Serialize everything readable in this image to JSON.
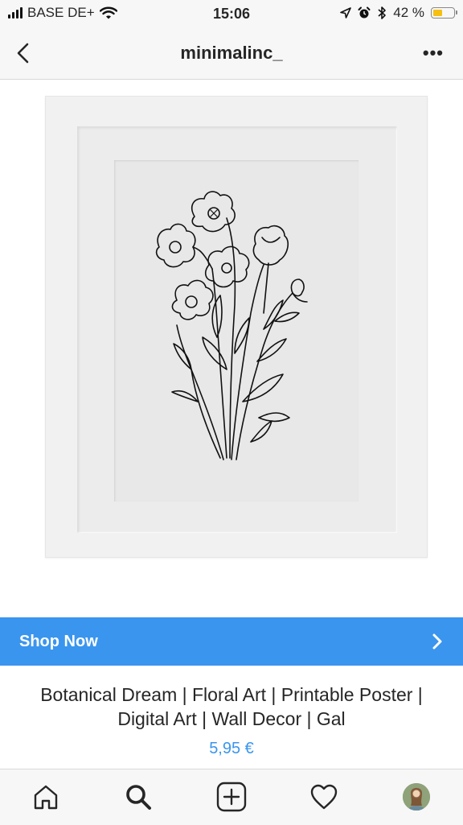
{
  "status_bar": {
    "carrier": "BASE DE+",
    "time": "15:06",
    "battery_percent": "42 %",
    "battery_level": 0.42,
    "icons": [
      "signal-bars-icon",
      "wifi-icon",
      "location-arrow-icon",
      "alarm-icon",
      "bluetooth-icon",
      "battery-icon"
    ]
  },
  "nav": {
    "title": "minimalinc_",
    "back_icon": "chevron-left-icon",
    "more_label": "•••"
  },
  "post": {
    "image_subject": "framed botanical line drawing of poppies"
  },
  "shop": {
    "label": "Shop Now",
    "icon": "chevron-right-icon",
    "accent_color": "#3a95ee"
  },
  "product": {
    "title": "Botanical Dream | Floral Art | Printable Poster | Digital Art | Wall Decor | Gal",
    "price": "5,95 €"
  },
  "tab_bar": {
    "tabs": [
      {
        "name": "home",
        "icon": "home-icon"
      },
      {
        "name": "search",
        "icon": "search-icon",
        "active": true
      },
      {
        "name": "new-post",
        "icon": "plus-square-icon"
      },
      {
        "name": "activity",
        "icon": "heart-icon"
      },
      {
        "name": "profile",
        "icon": "avatar"
      }
    ]
  }
}
